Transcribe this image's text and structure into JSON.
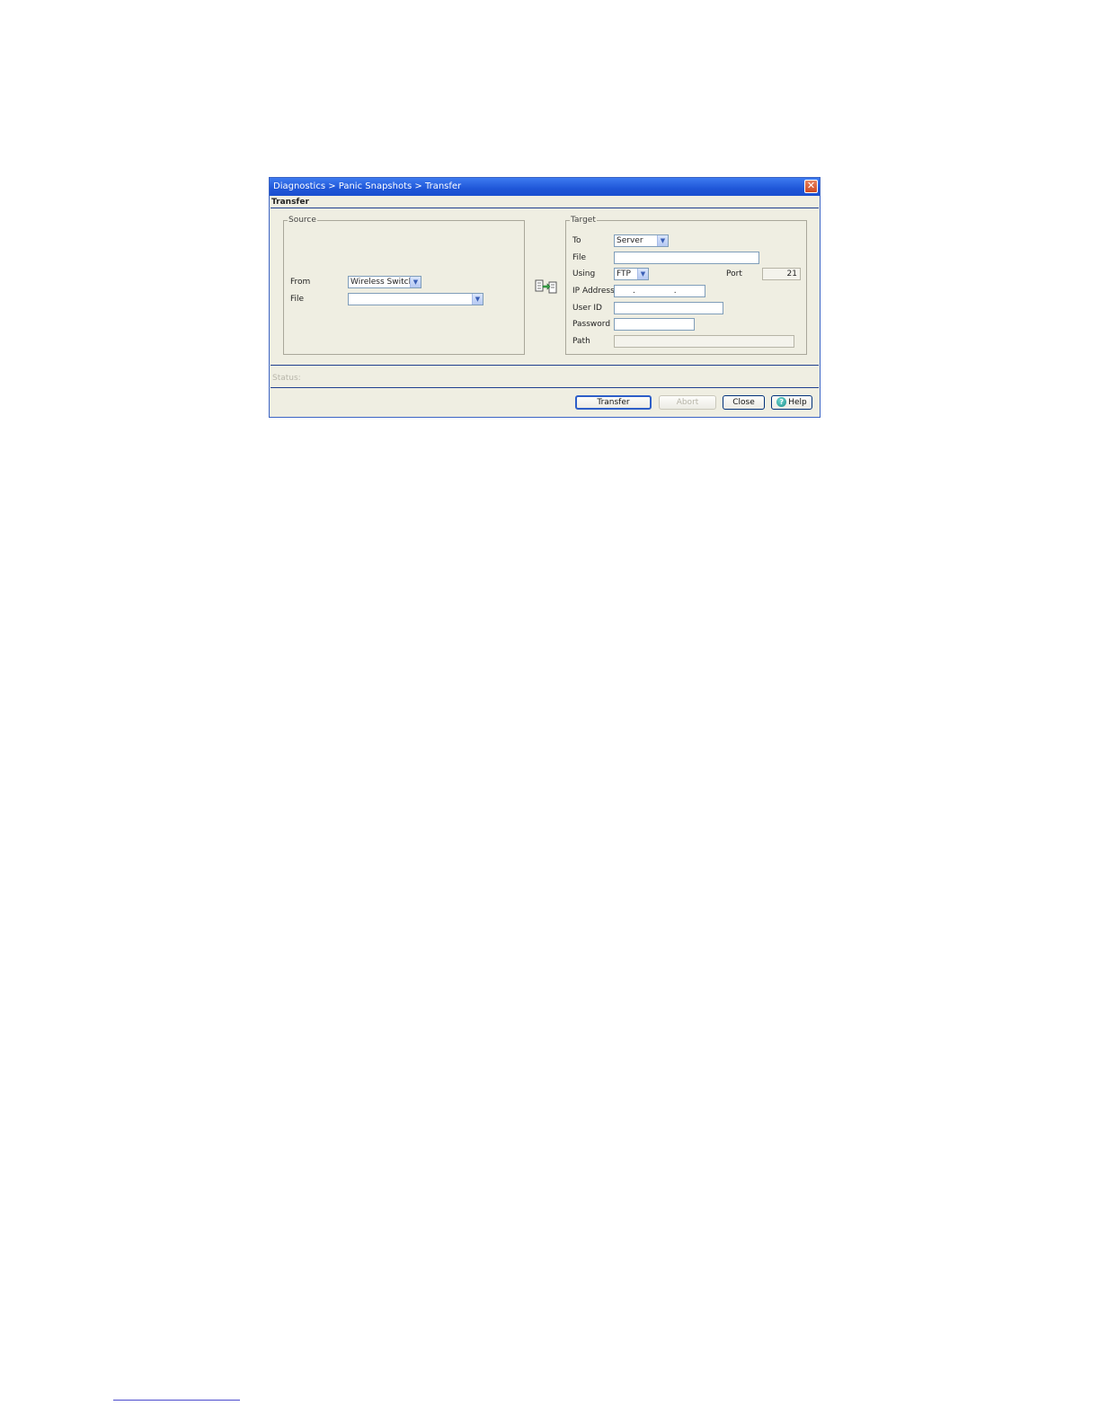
{
  "window": {
    "title": "Diagnostics > Panic Snapshots > Transfer",
    "close_glyph": "✕"
  },
  "section": {
    "title": "Transfer"
  },
  "source": {
    "legend": "Source",
    "from_label": "From",
    "from_value": "Wireless Switch",
    "file_label": "File",
    "file_value": ""
  },
  "target": {
    "legend": "Target",
    "to_label": "To",
    "to_value": "Server",
    "file_label": "File",
    "file_value": "",
    "using_label": "Using",
    "using_value": "FTP",
    "port_label": "Port",
    "port_value": "21",
    "ip_label": "IP Address",
    "ip_value": ". . .",
    "userid_label": "User ID",
    "userid_value": "",
    "password_label": "Password",
    "password_value": "",
    "path_label": "Path",
    "path_value": ""
  },
  "status": {
    "label": "Status:"
  },
  "buttons": {
    "transfer": "Transfer",
    "abort": "Abort",
    "close": "Close",
    "help": "Help",
    "help_glyph": "?"
  },
  "icons": {
    "dropdown_arrow": "▼",
    "transfer": "transfer-arrow-icon"
  },
  "colors": {
    "titlebar": "#1f56d8",
    "dialog_bg": "#efeee2",
    "accent_border": "#2d5ec8"
  }
}
